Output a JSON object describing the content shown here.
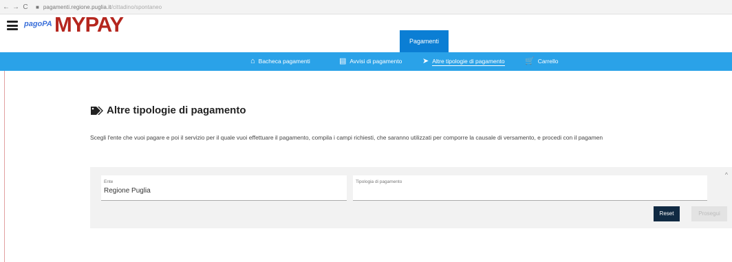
{
  "browser": {
    "back": "←",
    "forward": "→",
    "reload": "C",
    "url_host": "pagamenti.regione.puglia.it",
    "url_path": "/cittadino/spontaneo"
  },
  "header": {
    "brand_pagopa": "pagoPA",
    "brand_mypay": "MYPAY",
    "tab_label": "Pagamenti"
  },
  "nav": {
    "items": [
      {
        "label": "Bacheca pagamenti",
        "icon": "home-icon"
      },
      {
        "label": "Avvisi di pagamento",
        "icon": "document-icon"
      },
      {
        "label": "Altre tipologie di pagamento",
        "icon": "tags-icon"
      },
      {
        "label": "Carrello",
        "icon": "cart-icon"
      }
    ]
  },
  "page": {
    "title": "Altre tipologie di pagamento",
    "description": "Scegli l'ente che vuoi pagare e poi il servizio per il quale vuoi effettuare il pagamento, compila i campi richiesti, che saranno utilizzati per comporre la causale di versamento, e procedi con il pagamen"
  },
  "form": {
    "ente_label": "Ente",
    "ente_value": "Regione Puglia",
    "tipologia_label": "Tipologia di pagamento",
    "tipologia_value": "",
    "reset_label": "Reset",
    "prosegui_label": "Prosegui",
    "collapse_glyph": "^"
  },
  "colors": {
    "navbar": "#2aa2e8",
    "tab_active": "#0b7ed4",
    "brand_red": "#b5261e",
    "brand_blue": "#3a6fd9",
    "reset_button": "#102a43"
  }
}
